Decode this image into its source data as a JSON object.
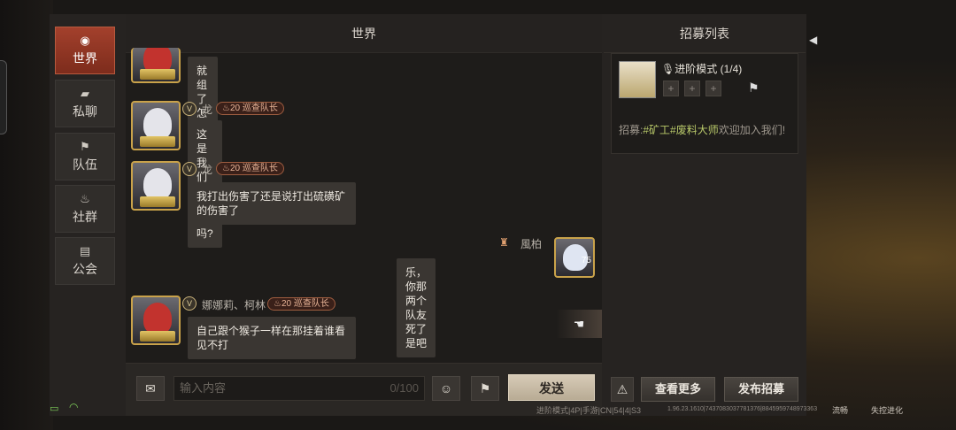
{
  "nav": [
    {
      "icon": "globe-icon",
      "glyph": "◉",
      "label": "世界",
      "active": true
    },
    {
      "icon": "chat-bubble-icon",
      "glyph": "▰",
      "label": "私聊",
      "active": false
    },
    {
      "icon": "flag-icon",
      "glyph": "⚑",
      "label": "队伍",
      "active": false
    },
    {
      "icon": "campfire-icon",
      "glyph": "♨",
      "label": "社群",
      "active": false
    },
    {
      "icon": "guild-icon",
      "glyph": "▤",
      "label": "公会",
      "active": false
    }
  ],
  "chat": {
    "title": "世界",
    "messages": [
      {
        "name": "",
        "text": "就组了怎么滴吧😂"
      },
      {
        "name": "龙",
        "badge_level": "20",
        "badge_title": "巡查队长",
        "text": "这是我们拆家的吗?"
      },
      {
        "name": "龙",
        "badge_level": "20",
        "badge_title": "巡查队长",
        "text": "我打出伤害了还是说打出硫磺矿的伤害了"
      },
      {
        "name": "風柏",
        "avatar_num": "75",
        "text": "乐，你那两个队友死了是吧"
      },
      {
        "name": "娜娜莉、柯林",
        "badge_level": "20",
        "badge_title": "巡查队长",
        "text": "自己跟个猴子一样在那挂着谁看见不打"
      }
    ],
    "input_placeholder": "输入内容",
    "input_count": "0/100",
    "send_label": "发送"
  },
  "recruit": {
    "title": "招募列表",
    "mode": "进阶模式 (1/4)",
    "slots": [
      "+",
      "+",
      "+"
    ],
    "text_prefix": "招募:",
    "tags": "#矿工#废料大师",
    "text_suffix": "欢迎加入我们!",
    "view_more": "查看更多",
    "post": "发布招募"
  },
  "status": {
    "mode_info": "进阶模式|4P|手游|CN|54|4|S3",
    "build": "1.96.23.1610|7437083037781376|8845959748973363",
    "network": "流畅",
    "recorder": "失控进化"
  },
  "colors": {
    "accent": "#a3402c",
    "send": "#d7cbb7",
    "tag": "#b9c96a"
  }
}
